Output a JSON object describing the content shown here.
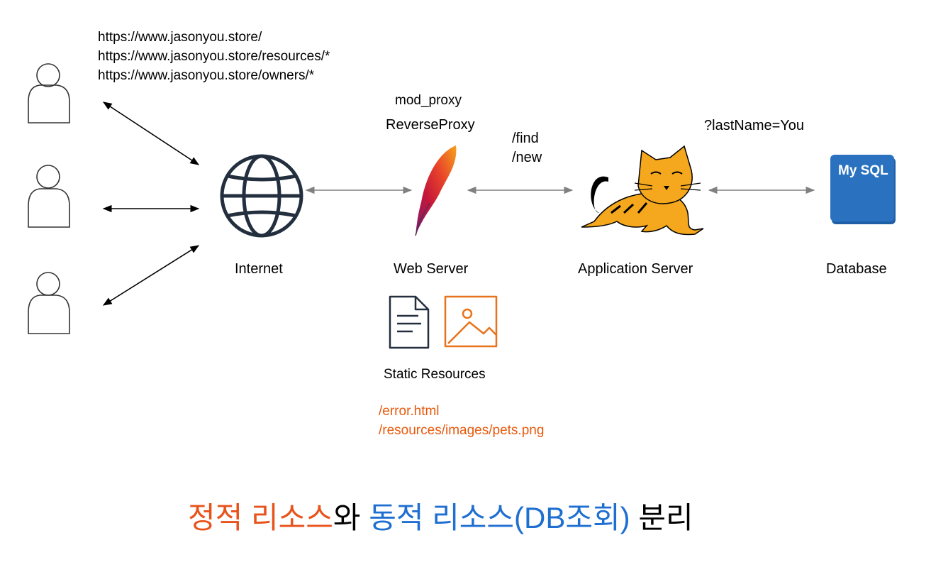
{
  "urls": [
    "https://www.jasonyou.store/",
    "https://www.jasonyou.store/resources/*",
    "https://www.jasonyou.store/owners/*"
  ],
  "webserver": {
    "module": "mod_proxy",
    "role": "ReverseProxy",
    "label": "Web Server"
  },
  "internet": {
    "label": "Internet"
  },
  "app_paths": [
    "/find",
    "/new"
  ],
  "query": "?lastName=You",
  "appserver": {
    "label": "Application Server"
  },
  "database": {
    "label": "Database",
    "logo_text": "My SQL"
  },
  "static": {
    "label": "Static Resources",
    "paths": [
      "/error.html",
      "/resources/images/pets.png"
    ]
  },
  "caption": {
    "part1": "정적 리소스",
    "part2": "와 ",
    "part3": "동적 리소스(DB조회)",
    "part4": " 분리"
  },
  "colors": {
    "orange": "#e8531b",
    "blue": "#1f6fd1",
    "mysql": "#2a72c0",
    "tomcat": "#f5a81d",
    "arrow_gray": "#808080"
  },
  "icons": [
    "user-icon",
    "globe-icon",
    "apache-feather-icon",
    "tomcat-icon",
    "mysql-icon",
    "document-icon",
    "image-icon"
  ]
}
